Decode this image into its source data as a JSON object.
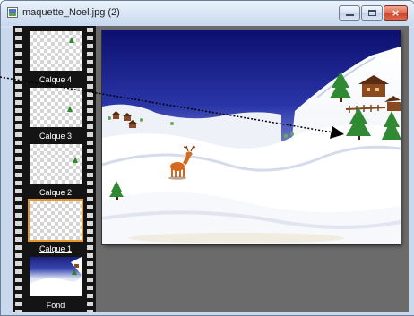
{
  "window": {
    "title": "maquette_Noel.jpg (2)",
    "icon": "image-file-icon",
    "controls": {
      "minimize": "minimize-icon",
      "maximize": "maximize-icon",
      "close": "×"
    }
  },
  "layers": [
    {
      "label": "Calque 4",
      "selected": false
    },
    {
      "label": "Calque 3",
      "selected": false
    },
    {
      "label": "Calque 2",
      "selected": false
    },
    {
      "label": "Calque 1",
      "selected": true
    },
    {
      "label": "Fond",
      "selected": false
    }
  ],
  "colors": {
    "selection": "#e8962d",
    "filmstrip": "#141414",
    "workspace": "#6b6b6b"
  }
}
